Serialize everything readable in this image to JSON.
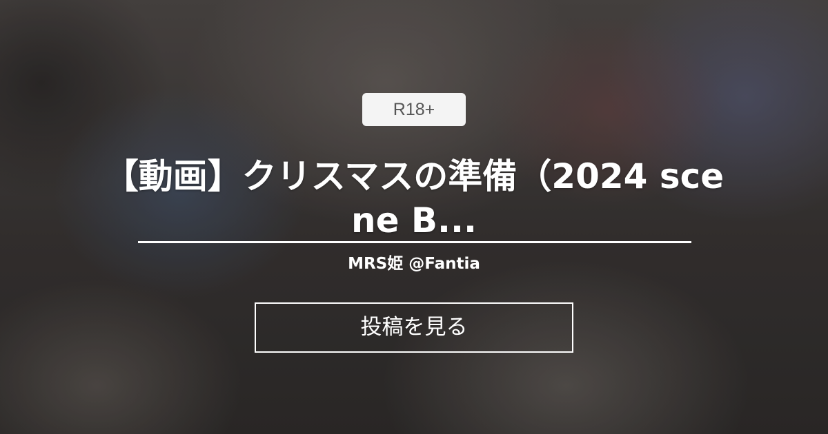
{
  "badge": {
    "rating": "R18+"
  },
  "post": {
    "title": "【動画】クリスマスの準備（2024 scene B...",
    "creator": "MRS姫 @Fantia"
  },
  "actions": {
    "view_post_label": "投稿を見る"
  }
}
